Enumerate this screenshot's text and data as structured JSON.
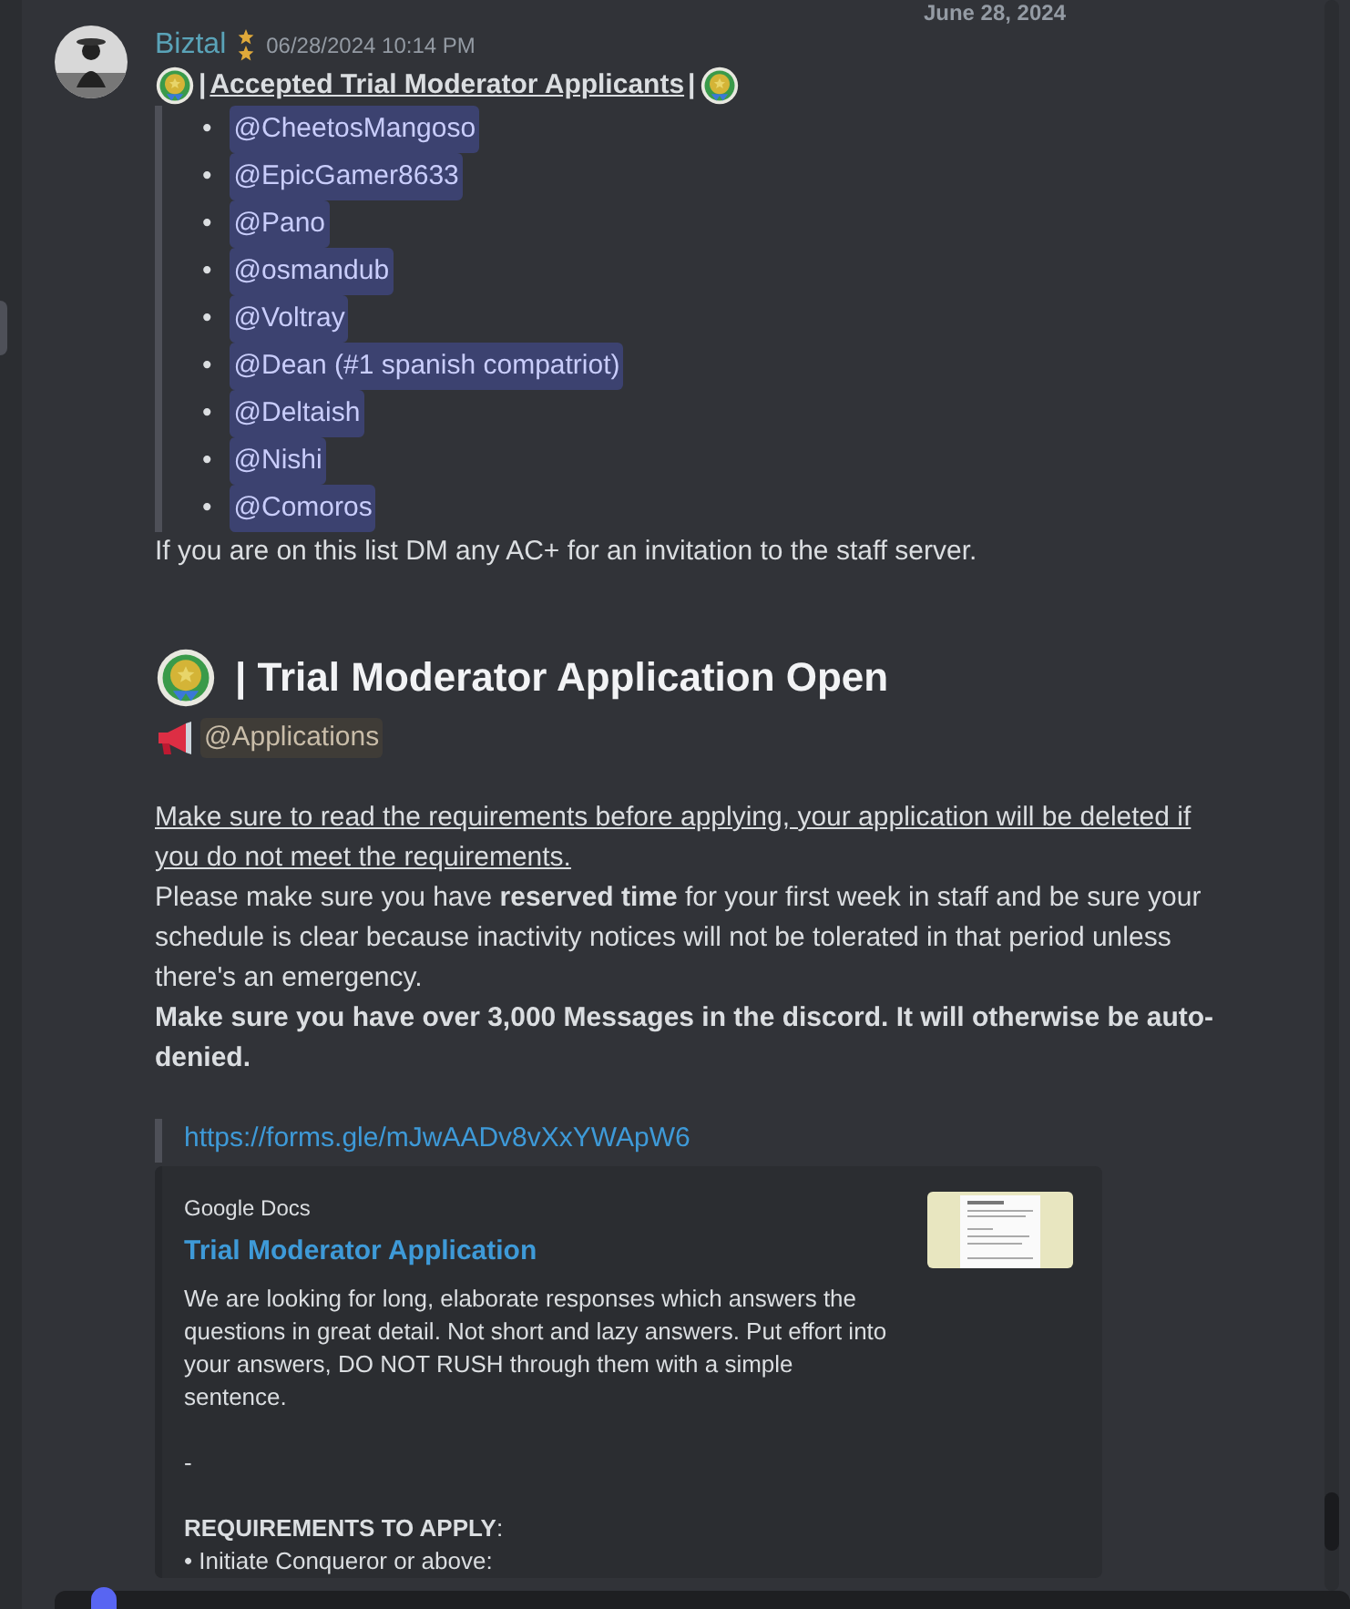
{
  "date_divider": "June 28, 2024",
  "message": {
    "author": "Biztal",
    "timestamp": "06/28/2024 10:14 PM",
    "heading": {
      "prefix": "|",
      "text": "Accepted Trial Moderator Applicants",
      "suffix": "|"
    },
    "mentions": [
      {
        "bullet": "•",
        "name": "@CheetosMangoso"
      },
      {
        "bullet": "•",
        "name": "@EpicGamer8633"
      },
      {
        "bullet": "•",
        "name": "@Pano"
      },
      {
        "bullet": "•",
        "name": "@osmandub"
      },
      {
        "bullet": "•",
        "name": "@Voltray"
      },
      {
        "bullet": "•",
        "name": "@Dean (#1 spanish compatriot)"
      },
      {
        "bullet": "•",
        "name": "@Deltaish"
      },
      {
        "bullet": "•",
        "name": "@Nishi"
      },
      {
        "bullet": "•",
        "name": "@Comoros"
      }
    ],
    "note": "If you are on this list DM any AC+ for an invitation to the staff server.",
    "section_title": "| Trial Moderator Application Open",
    "role_mention": "@Applications",
    "warning": "Make sure to read the requirements before applying, your application will be deleted if you do not meet the requirements.",
    "paragraph": "Please make sure you have **reserved time** for your first week in staff and be sure your schedule is clear because inactivity notices will not be tolerated in that period unless there's an emergency.",
    "bold_paragraph": "Make sure you have over 3,000 Messages in the discord. It will otherwise be auto-denied.",
    "link": "https://forms.gle/mJwAADv8vXxYWApW6",
    "embed": {
      "provider": "Google Docs",
      "title": "Trial Moderator Application",
      "description": "We are looking for long, elaborate responses which answers the questions in great detail. Not short and lazy answers. Put effort into your answers, DO NOT RUSH through them with a simple sentence.",
      "separator": "-",
      "requirements": "**REQUIREMENTS TO APPLY**:",
      "bullet": "• Initiate Conqueror or above:"
    }
  }
}
